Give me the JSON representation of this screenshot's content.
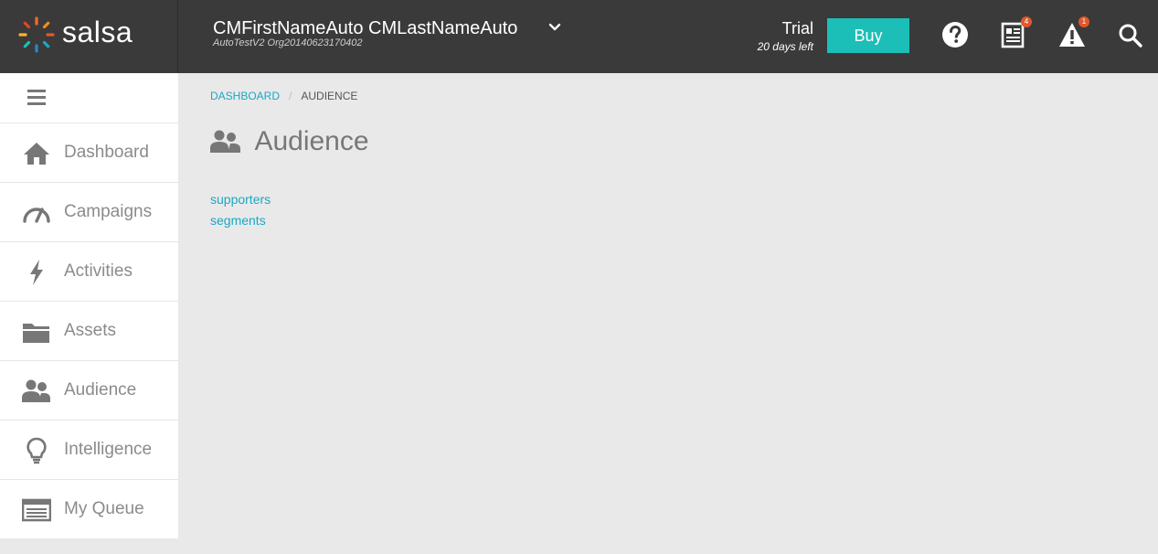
{
  "app": {
    "brand": "salsa",
    "user_name": "CMFirstNameAuto CMLastNameAuto",
    "org_name": "AutoTestV2 Org20140623170402",
    "trial_label": "Trial",
    "trial_days_left": "20 days left",
    "buy_label": "Buy",
    "news_badge": "4",
    "alert_badge": "1"
  },
  "sidebar": {
    "items": [
      {
        "label": "Dashboard",
        "icon": "home-icon"
      },
      {
        "label": "Campaigns",
        "icon": "gauge-icon"
      },
      {
        "label": "Activities",
        "icon": "bolt-icon"
      },
      {
        "label": "Assets",
        "icon": "folder-icon"
      },
      {
        "label": "Audience",
        "icon": "people-icon"
      },
      {
        "label": "Intelligence",
        "icon": "lightbulb-icon"
      },
      {
        "label": "My Queue",
        "icon": "list-icon"
      }
    ]
  },
  "breadcrumb": {
    "items": [
      "DASHBOARD",
      "AUDIENCE"
    ],
    "separator": "/"
  },
  "page": {
    "title": "Audience",
    "links": [
      "supporters",
      "segments"
    ]
  },
  "colors": {
    "topbar": "#3a3a3a",
    "accent": "#1bbfb7",
    "link": "#1aa8c4",
    "badge": "#e0582a"
  }
}
